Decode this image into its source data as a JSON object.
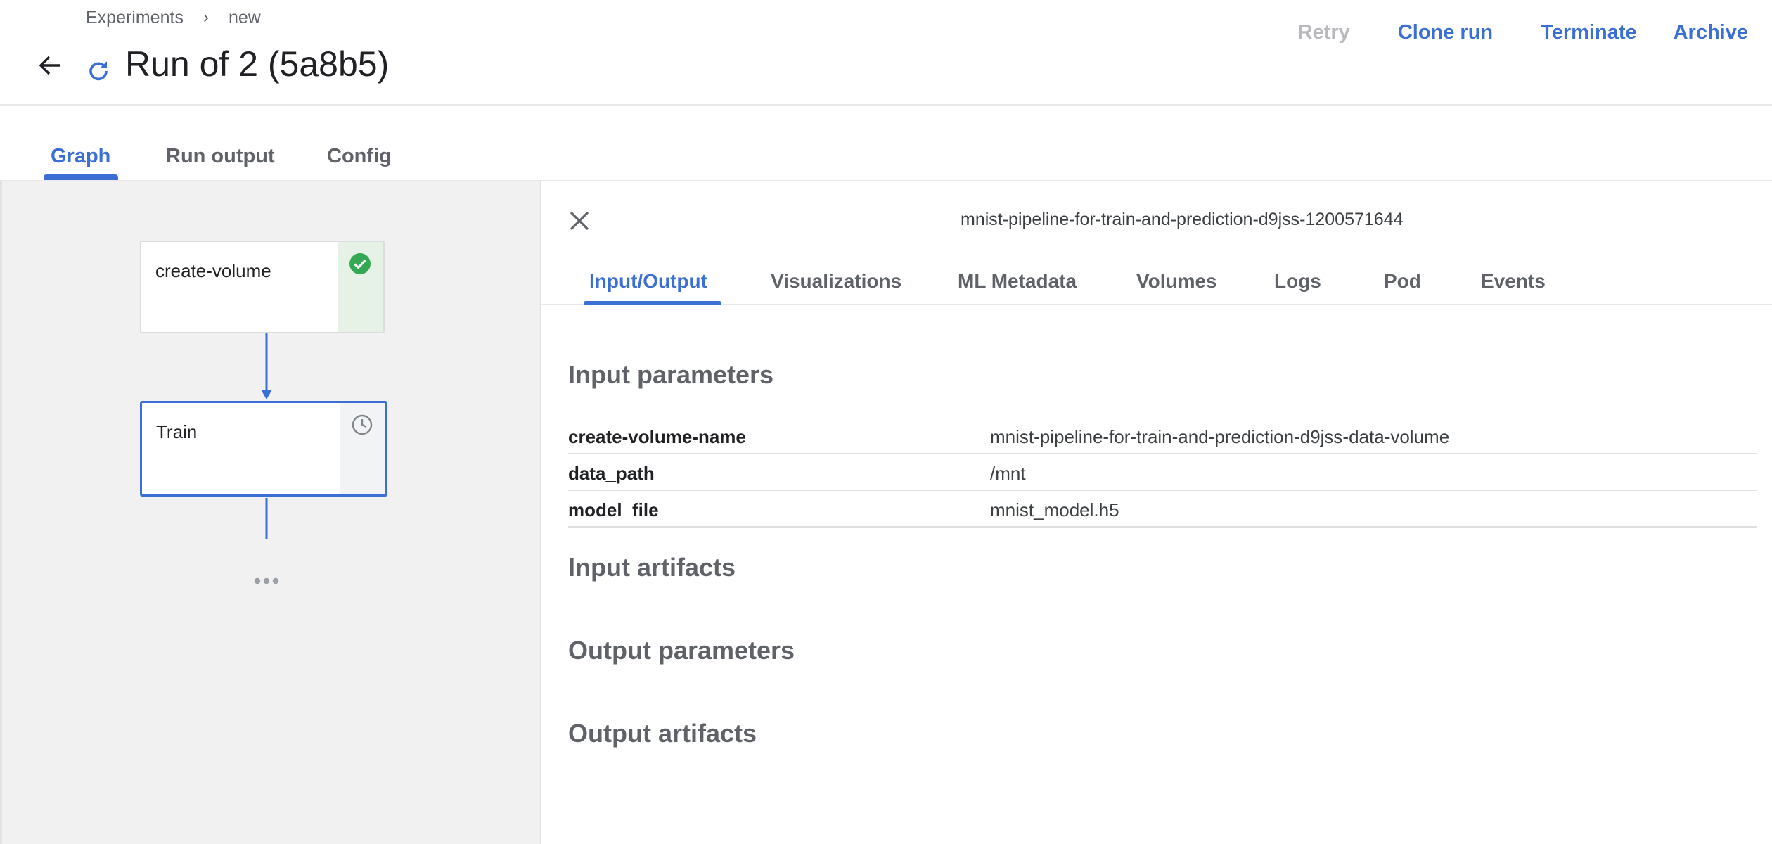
{
  "breadcrumb": {
    "items": [
      "Experiments",
      "new"
    ]
  },
  "header": {
    "title": "Run of 2 (5a8b5)",
    "status_icon": "running-refresh-icon",
    "back_icon": "arrow-back-icon"
  },
  "actions": {
    "retry": "Retry",
    "clone_run": "Clone run",
    "terminate": "Terminate",
    "archive": "Archive"
  },
  "tabs": [
    {
      "label": "Graph",
      "active": true
    },
    {
      "label": "Run output",
      "active": false
    },
    {
      "label": "Config",
      "active": false
    }
  ],
  "graph": {
    "nodes": [
      {
        "label": "create-volume",
        "status": "succeeded",
        "status_icon": "check-circle-icon"
      },
      {
        "label": "Train",
        "status": "pending",
        "status_icon": "clock-icon",
        "selected": true
      }
    ],
    "more_indicator": "more-dots-icon"
  },
  "side_panel": {
    "title": "mnist-pipeline-for-train-and-prediction-d9jss-1200571644",
    "tabs": [
      "Input/Output",
      "Visualizations",
      "ML Metadata",
      "Volumes",
      "Logs",
      "Pod",
      "Events"
    ],
    "active_tab": "Input/Output",
    "sections": {
      "input_parameters": "Input parameters",
      "input_artifacts": "Input artifacts",
      "output_parameters": "Output parameters",
      "output_artifacts": "Output artifacts"
    },
    "input_parameters": [
      {
        "key": "create-volume-name",
        "value": "mnist-pipeline-for-train-and-prediction-d9jss-data-volume"
      },
      {
        "key": "data_path",
        "value": "/mnt"
      },
      {
        "key": "model_file",
        "value": "mnist_model.h5"
      }
    ]
  },
  "colors": {
    "accent": "#3b6fd6",
    "success": "#34a853",
    "disabled": "#b7b9bd",
    "graph_bg": "#f1f1f1"
  }
}
